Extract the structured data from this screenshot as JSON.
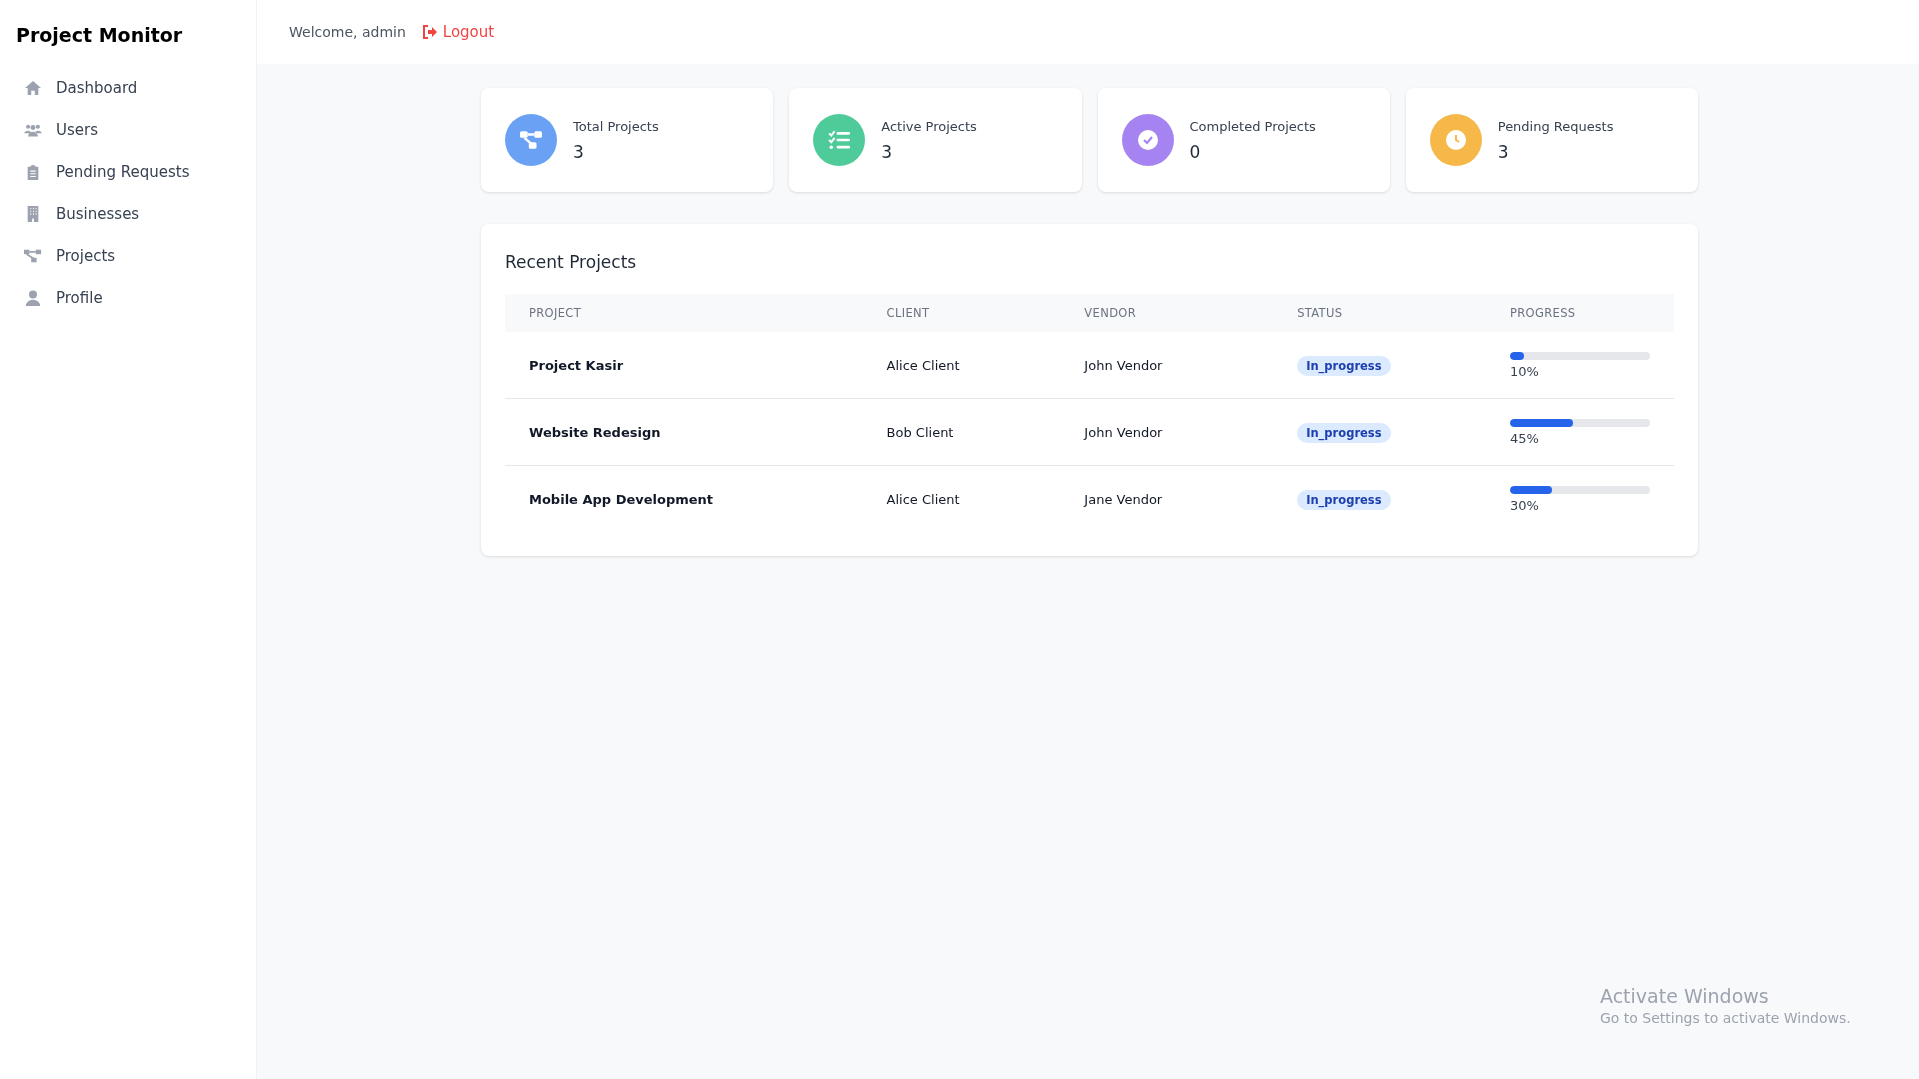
{
  "app_title": "Project Monitor",
  "sidebar": {
    "items": [
      {
        "label": "Dashboard",
        "kind": "home"
      },
      {
        "label": "Users",
        "kind": "users"
      },
      {
        "label": "Pending Requests",
        "kind": "clipboard"
      },
      {
        "label": "Businesses",
        "kind": "building"
      },
      {
        "label": "Projects",
        "kind": "diagram"
      },
      {
        "label": "Profile",
        "kind": "person"
      }
    ]
  },
  "header": {
    "welcome": "Welcome, admin",
    "logout": "Logout"
  },
  "stats": [
    {
      "label": "Total Projects",
      "value": "3",
      "kind": "diagram",
      "color": "#6ba1f5"
    },
    {
      "label": "Active Projects",
      "value": "3",
      "kind": "list",
      "color": "#4fcb9a"
    },
    {
      "label": "Completed Projects",
      "value": "0",
      "kind": "check",
      "color": "#a583f0"
    },
    {
      "label": "Pending Requests",
      "value": "3",
      "kind": "clock",
      "color": "#f7b84a"
    }
  ],
  "recent": {
    "title": "Recent Projects",
    "columns": [
      "PROJECT",
      "CLIENT",
      "VENDOR",
      "STATUS",
      "PROGRESS"
    ],
    "rows": [
      {
        "project": "Project Kasir",
        "client": "Alice Client",
        "vendor": "John Vendor",
        "status": "In_progress",
        "level": 0.1,
        "reading": "10%"
      },
      {
        "project": "Website Redesign",
        "client": "Bob Client",
        "vendor": "John Vendor",
        "status": "In_progress",
        "level": 0.45,
        "reading": "45%"
      },
      {
        "project": "Mobile App Development",
        "client": "Alice Client",
        "vendor": "Jane Vendor",
        "status": "In_progress",
        "level": 0.3,
        "reading": "30%"
      }
    ]
  },
  "os_notice": {
    "title": "Activate Windows",
    "subtitle": "Go to Settings to activate Windows."
  }
}
